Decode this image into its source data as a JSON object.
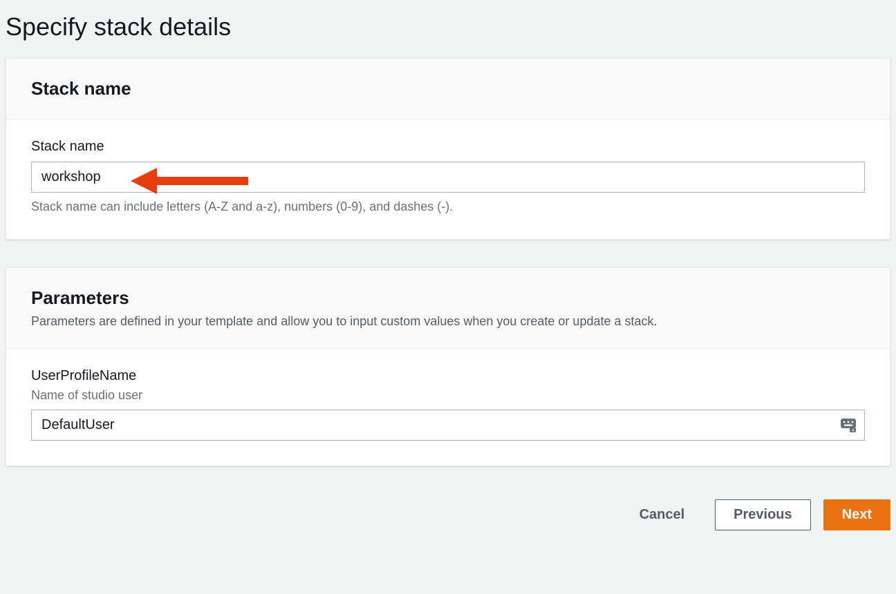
{
  "page": {
    "title": "Specify stack details"
  },
  "stackName": {
    "sectionTitle": "Stack name",
    "fieldLabel": "Stack name",
    "value": "workshop",
    "helpText": "Stack name can include letters (A-Z and a-z), numbers (0-9), and dashes (-)."
  },
  "parameters": {
    "sectionTitle": "Parameters",
    "sectionDesc": "Parameters are defined in your template and allow you to input custom values when you create or update a stack.",
    "items": [
      {
        "label": "UserProfileName",
        "sublabel": "Name of studio user",
        "value": "DefaultUser"
      }
    ]
  },
  "buttons": {
    "cancel": "Cancel",
    "previous": "Previous",
    "next": "Next"
  }
}
